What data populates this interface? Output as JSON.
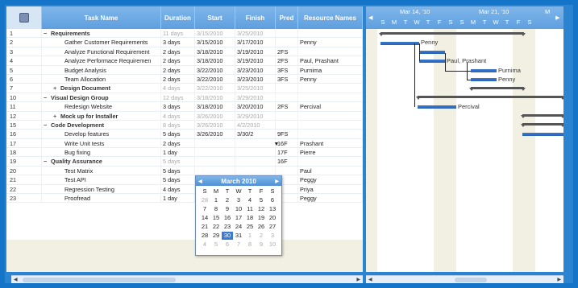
{
  "grid": {
    "columns": [
      "Task Name",
      "Duration",
      "Start",
      "Finish",
      "Pred",
      "Resource Names"
    ],
    "rows": [
      {
        "id": "1",
        "name": "Requirements",
        "dur": "11 days",
        "start": "3/15/2010",
        "finish": "3/25/2010",
        "pred": "",
        "res": "",
        "level": 0,
        "summary": true,
        "grey": true,
        "exp": "−"
      },
      {
        "id": "2",
        "name": "Gather Customer Requirements",
        "dur": "3 days",
        "start": "3/15/2010",
        "finish": "3/17/2010",
        "pred": "",
        "res": "Penny",
        "level": 2
      },
      {
        "id": "3",
        "name": "Analyze Functional Requirement",
        "dur": "2 days",
        "start": "3/18/2010",
        "finish": "3/19/2010",
        "pred": "2FS",
        "res": "",
        "level": 2
      },
      {
        "id": "4",
        "name": "Analyze Performace Requiremen",
        "dur": "2 days",
        "start": "3/18/2010",
        "finish": "3/19/2010",
        "pred": "2FS",
        "res": "Paul, Prashant",
        "level": 2
      },
      {
        "id": "5",
        "name": "Budget Analysis",
        "dur": "2 days",
        "start": "3/22/2010",
        "finish": "3/23/2010",
        "pred": "3FS",
        "res": "Purnima",
        "level": 2
      },
      {
        "id": "6",
        "name": "Team Allocation",
        "dur": "2 days",
        "start": "3/22/2010",
        "finish": "3/23/2010",
        "pred": "3FS",
        "res": "Penny",
        "level": 2
      },
      {
        "id": "7",
        "name": "Design Document",
        "dur": "4 days",
        "start": "3/22/2010",
        "finish": "3/25/2010",
        "pred": "",
        "res": "",
        "level": 1,
        "summary": true,
        "grey": true,
        "exp": "+"
      },
      {
        "id": "10",
        "name": "Visual Design Group",
        "dur": "12 days",
        "start": "3/18/2010",
        "finish": "3/29/2010",
        "pred": "",
        "res": "",
        "level": 0,
        "summary": true,
        "grey": true,
        "exp": "−"
      },
      {
        "id": "11",
        "name": "Redesign Website",
        "dur": "3 days",
        "start": "3/18/2010",
        "finish": "3/20/2010",
        "pred": "2FS",
        "res": "Percival",
        "level": 2
      },
      {
        "id": "12",
        "name": "Mock up for Installer",
        "dur": "4 days",
        "start": "3/26/2010",
        "finish": "3/29/2010",
        "pred": "",
        "res": "",
        "level": 1,
        "summary": true,
        "grey": true,
        "exp": "+"
      },
      {
        "id": "15",
        "name": "Code Development",
        "dur": "8 days",
        "start": "3/26/2010",
        "finish": "4/2/2010",
        "pred": "",
        "res": "",
        "level": 0,
        "summary": true,
        "grey": true,
        "exp": "−"
      },
      {
        "id": "16",
        "name": "Develop features",
        "dur": "5 days",
        "start": "3/26/2010",
        "finish": "3/30/2",
        "pred": "9FS",
        "res": "",
        "level": 2
      },
      {
        "id": "17",
        "name": "Write Unit tests",
        "dur": "2 days",
        "start": "",
        "finish": "",
        "pred": "16F",
        "res": "Prashant",
        "level": 2
      },
      {
        "id": "18",
        "name": "Bug fixing",
        "dur": "1 day",
        "start": "",
        "finish": "",
        "pred": "17F",
        "res": "Pierre",
        "level": 2
      },
      {
        "id": "19",
        "name": "Quality Assurance",
        "dur": "5 days",
        "start": "",
        "finish": "",
        "pred": "16F",
        "res": "",
        "level": 0,
        "summary": true,
        "grey": true,
        "exp": "−"
      },
      {
        "id": "20",
        "name": "Test Matrix",
        "dur": "5 days",
        "start": "",
        "finish": "",
        "pred": "",
        "res": "Paul",
        "level": 2
      },
      {
        "id": "21",
        "name": "Test API",
        "dur": "5 days",
        "start": "",
        "finish": "",
        "pred": "",
        "res": "Peggy",
        "level": 2
      },
      {
        "id": "22",
        "name": "Regression Testing",
        "dur": "4 days",
        "start": "",
        "finish": "",
        "pred": "",
        "res": "Priya",
        "level": 2
      },
      {
        "id": "23",
        "name": "Proofread",
        "dur": "1 day",
        "start": "",
        "finish": "",
        "pred": "",
        "res": "Peggy",
        "level": 2
      }
    ]
  },
  "datepicker": {
    "title": "March 2010",
    "dow": [
      "S",
      "M",
      "T",
      "W",
      "T",
      "F",
      "S"
    ],
    "days": [
      [
        "28",
        "1",
        "2",
        "3",
        "4",
        "5",
        "6"
      ],
      [
        "7",
        "8",
        "9",
        "10",
        "11",
        "12",
        "13"
      ],
      [
        "14",
        "15",
        "16",
        "17",
        "18",
        "19",
        "20"
      ],
      [
        "21",
        "22",
        "23",
        "24",
        "25",
        "26",
        "27"
      ],
      [
        "28",
        "29",
        "30",
        "31",
        "1",
        "2",
        "3"
      ],
      [
        "4",
        "5",
        "6",
        "7",
        "8",
        "9",
        "10"
      ]
    ],
    "selected": "30"
  },
  "gantt": {
    "weeks": [
      "Mar 14, '10",
      "Mar 21, '10",
      "M"
    ],
    "days": [
      "S",
      "M",
      "T",
      "W",
      "T",
      "F",
      "S",
      "S",
      "M",
      "T",
      "W",
      "T",
      "F",
      "S"
    ],
    "labels": [
      "Penny",
      "Paul, Prashant",
      "Purnima",
      "Penny",
      "Percival"
    ]
  },
  "colors": {
    "header": "#5f9fdf",
    "bar": "#2a62b5",
    "summary": "#555555",
    "weekend": "#f2efe3",
    "frame": "#1474c8"
  }
}
